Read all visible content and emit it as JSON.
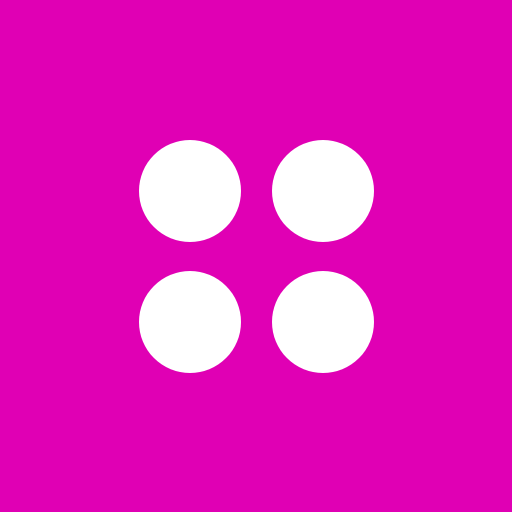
{
  "icon": {
    "name": "four-dots-grid-icon",
    "background_color": "#E000B4",
    "dot_color": "#FFFFFF"
  }
}
